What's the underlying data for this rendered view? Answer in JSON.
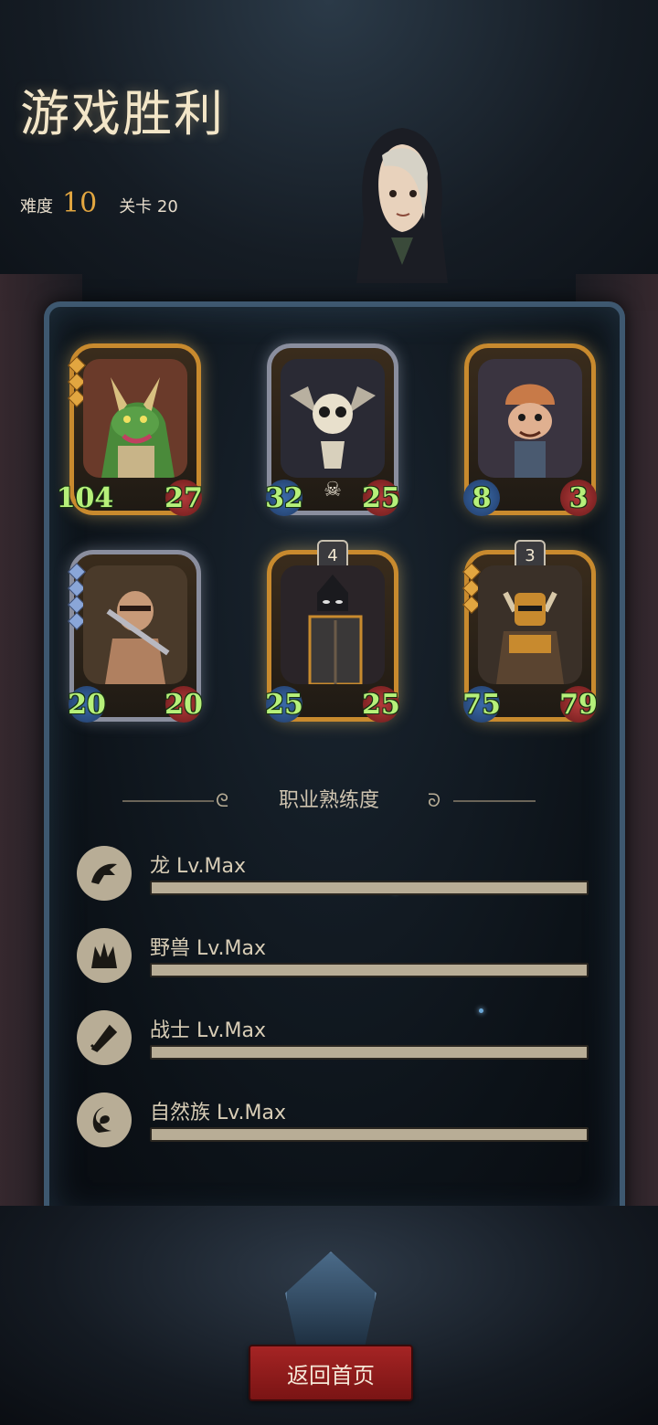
{
  "header": {
    "title": "游戏胜利",
    "difficulty_label": "难度",
    "difficulty_value": "10",
    "stage_label": "关卡 20"
  },
  "cards": [
    {
      "name": "dragon",
      "atk": "104",
      "hp": "27",
      "tier": "",
      "gems": 3,
      "gem_color": "gold",
      "frame": "gold"
    },
    {
      "name": "skeleton-bat",
      "atk": "32",
      "hp": "25",
      "tier": "",
      "gems": 0,
      "gem_color": "",
      "frame": "silver"
    },
    {
      "name": "goblin-wizard",
      "atk": "8",
      "hp": "3",
      "tier": "",
      "gems": 0,
      "gem_color": "",
      "frame": "gold"
    },
    {
      "name": "barbarian",
      "atk": "20",
      "hp": "20",
      "tier": "",
      "gems": 4,
      "gem_color": "blue",
      "frame": "silver"
    },
    {
      "name": "shield-knight",
      "atk": "25",
      "hp": "25",
      "tier": "4",
      "gems": 0,
      "gem_color": "",
      "frame": "gold"
    },
    {
      "name": "horned-warrior",
      "atk": "75",
      "hp": "79",
      "tier": "3",
      "gems": 3,
      "gem_color": "gold",
      "frame": "gold"
    }
  ],
  "proficiency": {
    "title": "职业熟练度",
    "items": [
      {
        "label": "龙 Lv.Max",
        "icon": "dragon-icon",
        "progress": 1.0
      },
      {
        "label": "野兽 Lv.Max",
        "icon": "beast-icon",
        "progress": 1.0
      },
      {
        "label": "战士 Lv.Max",
        "icon": "warrior-icon",
        "progress": 1.0
      },
      {
        "label": "自然族 Lv.Max",
        "icon": "nature-icon",
        "progress": 1.0
      }
    ]
  },
  "footer": {
    "home_button": "返回首页"
  },
  "colors": {
    "accent_gold": "#e2a640",
    "stat_green": "#b6f07a",
    "button_red": "#a52424"
  }
}
